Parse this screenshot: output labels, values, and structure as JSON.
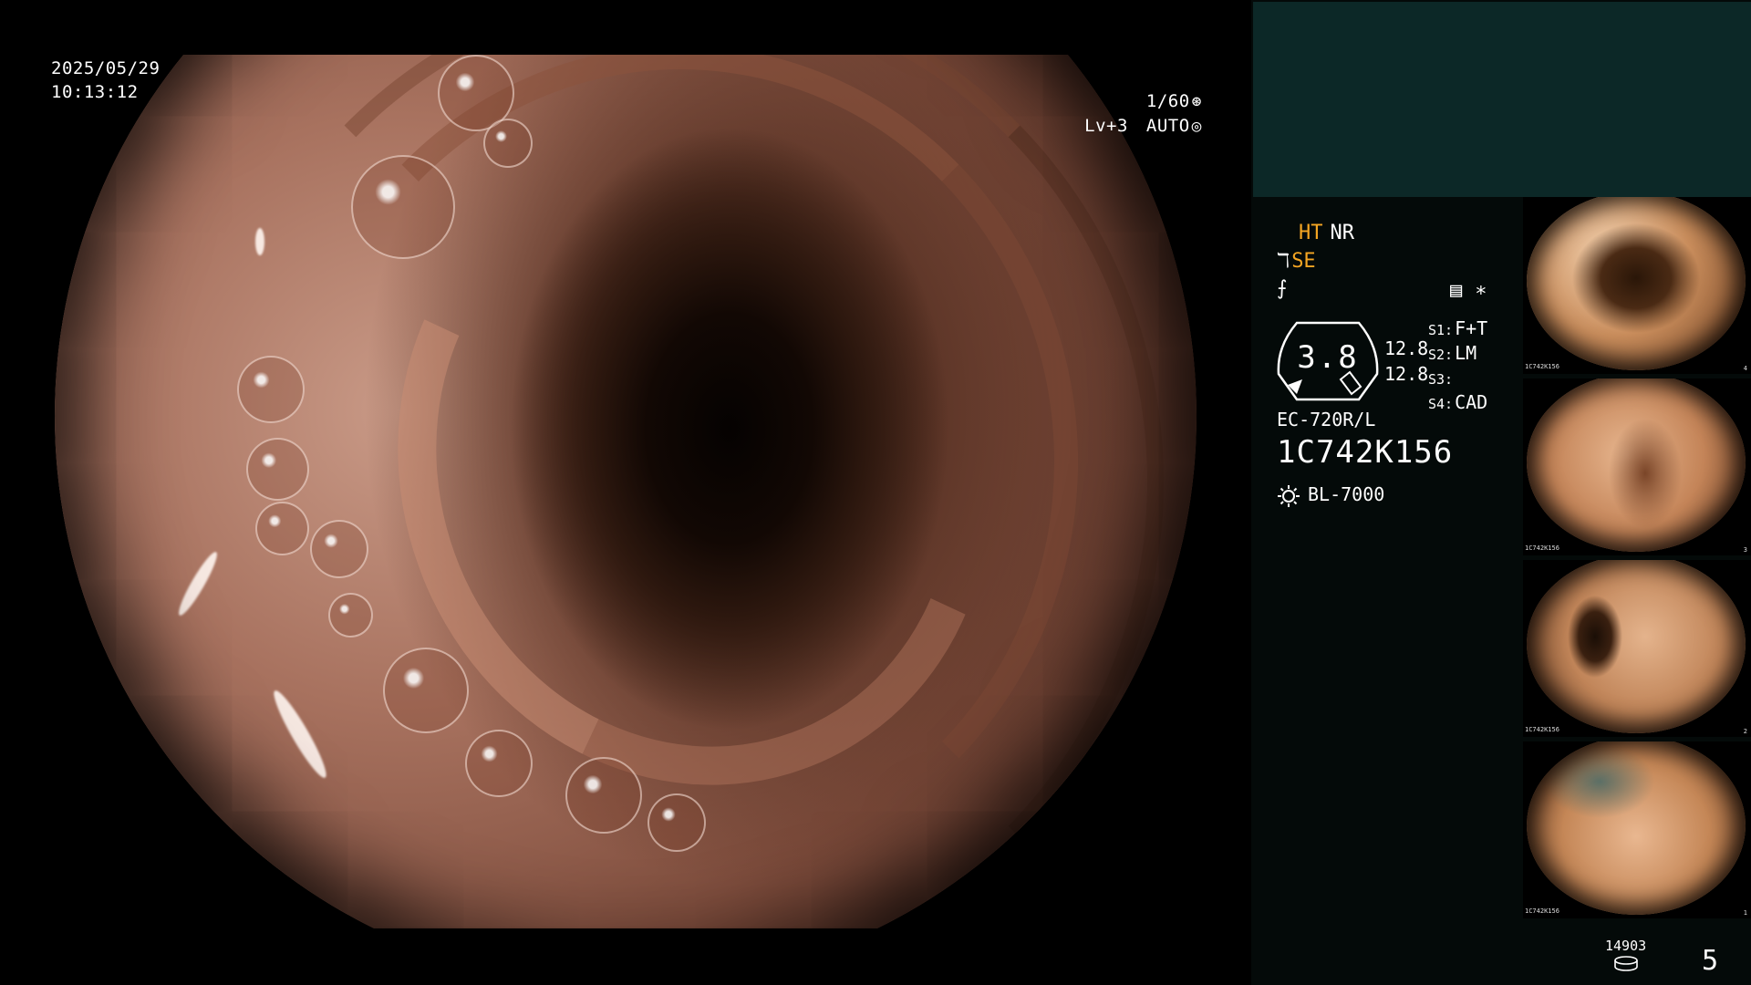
{
  "main_view": {
    "date": "2025/05/29",
    "time": "10:13:12",
    "shutter": "1/60",
    "level": "Lv+3",
    "iris": "AUTO"
  },
  "status": {
    "ht": "HT",
    "nr": "NR",
    "se": "SE",
    "gauge_value": "3.8",
    "reading_1": "12.8",
    "reading_2": "12.8",
    "switches": [
      {
        "label": "S1:",
        "value": "F+T"
      },
      {
        "label": "S2:",
        "value": "LM"
      },
      {
        "label": "S3:",
        "value": ""
      },
      {
        "label": "S4:",
        "value": "CAD"
      }
    ],
    "scope_model": "EC-720R/L",
    "serial": "1C742K156",
    "light_source": "BL-7000"
  },
  "thumbnails": [
    {
      "serial": "1C742K156",
      "index": "4"
    },
    {
      "serial": "1C742K156",
      "index": "3"
    },
    {
      "serial": "1C742K156",
      "index": "2"
    },
    {
      "serial": "1C742K156",
      "index": "1"
    }
  ],
  "footer": {
    "storage_count": "14903",
    "image_number": "5"
  },
  "colors": {
    "accent": "#f5a623",
    "panel_top": "#0c2827",
    "panel_bg": "#040a09"
  },
  "icons": {
    "shutter": "aperture-icon",
    "iris": "iris-icon",
    "light": "sun-icon",
    "storage": "disk-stack-icon"
  }
}
